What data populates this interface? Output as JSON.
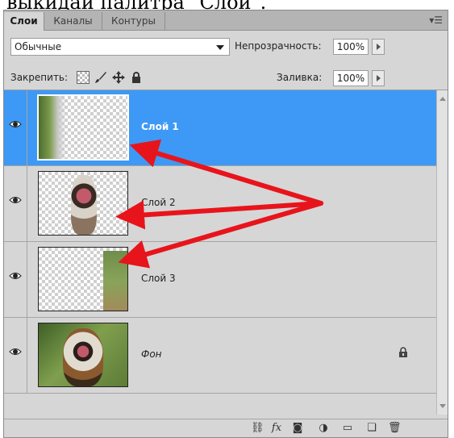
{
  "caption": "выкидаи палитра \"Слои\".",
  "tabs": [
    {
      "label": "Слои",
      "active": true
    },
    {
      "label": "Каналы",
      "active": false
    },
    {
      "label": "Контуры",
      "active": false
    }
  ],
  "blend_mode": {
    "value": "Обычные"
  },
  "opacity": {
    "label": "Непрозрачность:",
    "value": "100%"
  },
  "lock": {
    "label": "Закрепить:",
    "icons": [
      "transparent-pixels-lock-icon",
      "brush-icon",
      "move-icon",
      "lock-icon"
    ]
  },
  "fill": {
    "label": "Заливка:",
    "value": "100%"
  },
  "layers": [
    {
      "name": "Слой 1",
      "selected": true,
      "visible": true,
      "italic": false,
      "locked": false
    },
    {
      "name": "Слой 2",
      "selected": false,
      "visible": true,
      "italic": false,
      "locked": false
    },
    {
      "name": "Слой 3",
      "selected": false,
      "visible": true,
      "italic": false,
      "locked": false
    },
    {
      "name": "Фон",
      "selected": false,
      "visible": true,
      "italic": true,
      "locked": true
    }
  ],
  "bottom_icons": [
    "link-icon",
    "fx-icon",
    "mask-icon",
    "adjustment-icon",
    "folder-icon",
    "new-layer-icon",
    "trash-icon"
  ],
  "bottom_fx_label": "fx",
  "colors": {
    "selection": "#3d99f5",
    "panel": "#d6d6d6",
    "arrow": "#e8141c"
  }
}
